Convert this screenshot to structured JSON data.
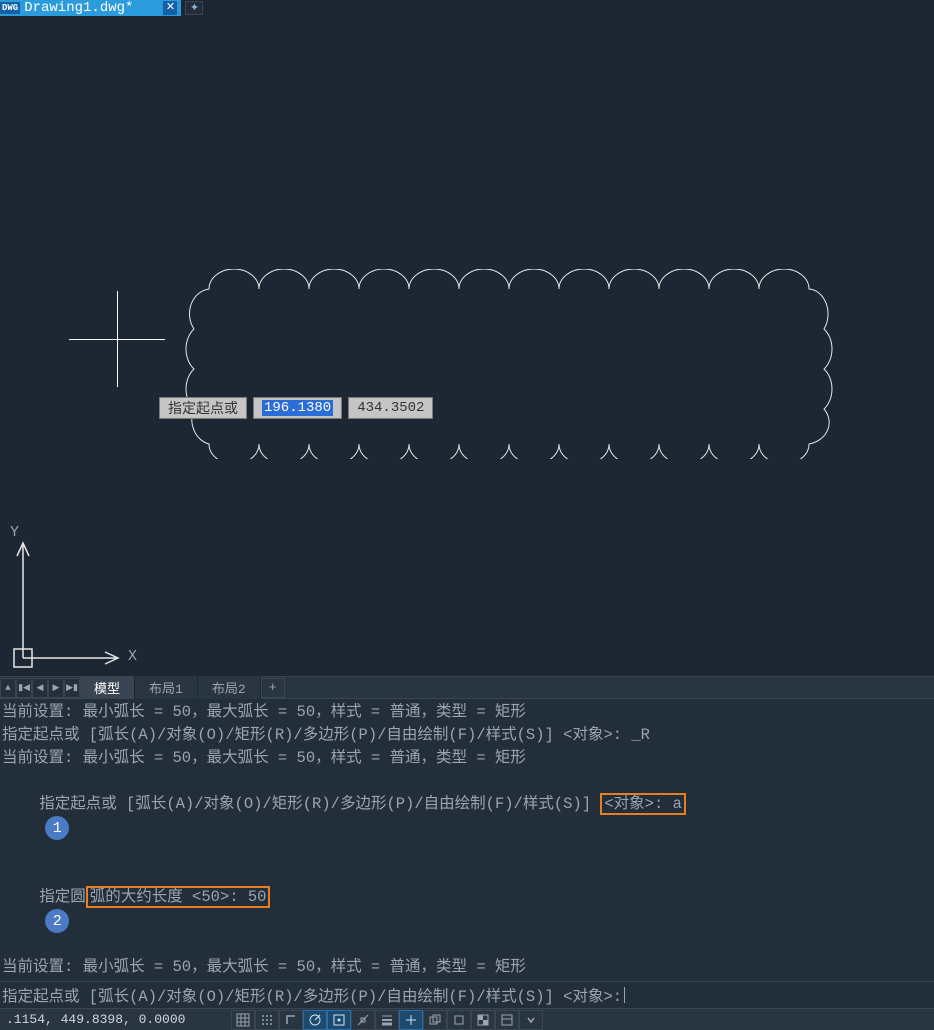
{
  "tab": {
    "badge": "DWG",
    "filename": "Drawing1.dwg*",
    "close": "✕",
    "new": "✦"
  },
  "dynamic_input": {
    "prompt": "指定起点或",
    "value_x": "196.1380",
    "value_y": "434.3502"
  },
  "ucs": {
    "x_label": "X",
    "y_label": "Y"
  },
  "layout_tabs": {
    "arrows": [
      "▲",
      "◀",
      "◀◀",
      "▶",
      "▶▶"
    ],
    "model": "模型",
    "layout1": "布局1",
    "layout2": "布局2",
    "plus": "+"
  },
  "history": {
    "l1": "当前设置: 最小弧长 = 50，最大弧长 = 50，样式 = 普通，类型 = 矩形",
    "l2": "指定起点或 [弧长(A)/对象(O)/矩形(R)/多边形(P)/自由绘制(F)/样式(S)] <对象>: _R",
    "l3": "当前设置: 最小弧长 = 50，最大弧长 = 50，样式 = 普通，类型 = 矩形",
    "l4a": "指定起点或 [弧长(A)/对象(O)/矩形(R)/多边形(P)/自由绘制(F)/样式(S)] ",
    "l4b": "<对象>: a",
    "badge1": "1",
    "l5a": "指定圆",
    "l5b": "弧的大约长度 <50>: 50",
    "badge2": "2",
    "l6": "当前设置: 最小弧长 = 50，最大弧长 = 50，样式 = 普通，类型 = 矩形"
  },
  "command_line": {
    "text": "指定起点或 [弧长(A)/对象(O)/矩形(R)/多边形(P)/自由绘制(F)/样式(S)] <对象>:"
  },
  "status": {
    "coords": ".1154, 449.8398, 0.0000"
  }
}
